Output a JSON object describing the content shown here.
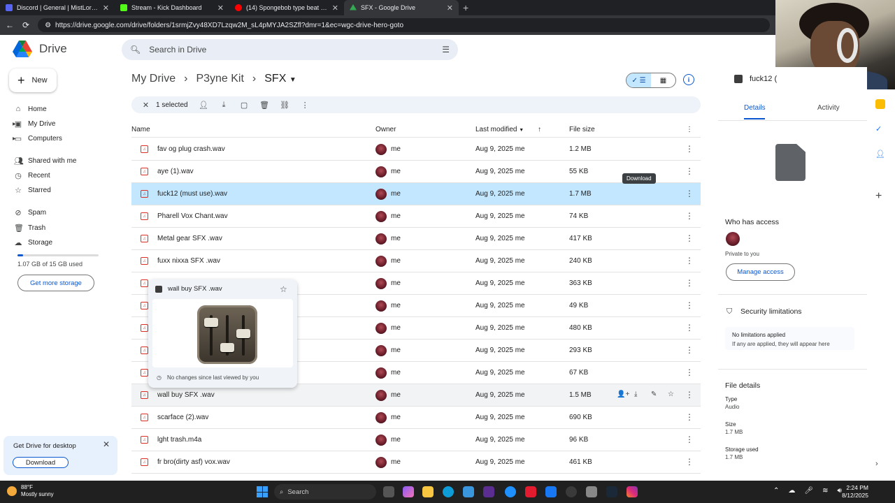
{
  "browser": {
    "tabs": [
      {
        "label": "Discord | General | MistLordRx's P...",
        "color": "#5865f2"
      },
      {
        "label": "Stream - Kick Dashboard",
        "color": "#53fc18"
      },
      {
        "label": "(14) Spongebob type beat p...",
        "color": "#ff0000"
      },
      {
        "label": "SFX - Google Drive",
        "color": "#34a853"
      }
    ],
    "url": "https://drive.google.com/drive/folders/1srmjZvy48XD7Lzqw2M_sL4pMYJA2SZfl?dmr=1&ec=wgc-drive-hero-goto"
  },
  "header": {
    "app_name": "Drive",
    "search_placeholder": "Search in Drive"
  },
  "sidebar": {
    "new_label": "New",
    "items": [
      {
        "label": "Home",
        "icon": "home-icon"
      },
      {
        "label": "My Drive",
        "icon": "drive-icon"
      },
      {
        "label": "Computers",
        "icon": "computer-icon"
      },
      {
        "label": "Shared with me",
        "icon": "people-icon"
      },
      {
        "label": "Recent",
        "icon": "clock-icon"
      },
      {
        "label": "Starred",
        "icon": "star-icon"
      },
      {
        "label": "Spam",
        "icon": "spam-icon"
      },
      {
        "label": "Trash",
        "icon": "trash-icon"
      },
      {
        "label": "Storage",
        "icon": "cloud-icon"
      }
    ],
    "storage_text": "1.07 GB of 15 GB used",
    "storage_fraction": 0.071,
    "get_more_label": "Get more storage",
    "desktop_promo": {
      "title": "Get Drive for desktop",
      "button": "Download"
    }
  },
  "main": {
    "breadcrumbs": [
      "My Drive",
      "P3yne Kit",
      "SFX"
    ],
    "selection": {
      "count_label": "1 selected"
    },
    "columns": {
      "name": "Name",
      "owner": "Owner",
      "modified": "Last modified",
      "size": "File size"
    },
    "tooltip": "Download",
    "files": [
      {
        "name": "fav og plug crash.wav",
        "owner": "me",
        "modified": "Aug 9, 2025 me",
        "size": "1.2 MB"
      },
      {
        "name": "aye (1).wav",
        "owner": "me",
        "modified": "Aug 9, 2025 me",
        "size": "55 KB"
      },
      {
        "name": "fuck12 (must use).wav",
        "owner": "me",
        "modified": "Aug 9, 2025 me",
        "size": "1.7 MB"
      },
      {
        "name": "Pharell Vox Chant.wav",
        "owner": "me",
        "modified": "Aug 9, 2025 me",
        "size": "74 KB"
      },
      {
        "name": "Metal gear SFX .wav",
        "owner": "me",
        "modified": "Aug 9, 2025 me",
        "size": "417 KB"
      },
      {
        "name": "fuxx nixxa SFX .wav",
        "owner": "me",
        "modified": "Aug 9, 2025 me",
        "size": "240 KB"
      },
      {
        "name": "",
        "owner": "me",
        "modified": "Aug 9, 2025 me",
        "size": "363 KB"
      },
      {
        "name": "",
        "owner": "me",
        "modified": "Aug 9, 2025 me",
        "size": "49 KB"
      },
      {
        "name": "",
        "owner": "me",
        "modified": "Aug 9, 2025 me",
        "size": "480 KB"
      },
      {
        "name": "",
        "owner": "me",
        "modified": "Aug 9, 2025 me",
        "size": "293 KB"
      },
      {
        "name": "",
        "owner": "me",
        "modified": "Aug 9, 2025 me",
        "size": "67 KB"
      },
      {
        "name": "wall buy SFX .wav",
        "owner": "me",
        "modified": "Aug 9, 2025 me",
        "size": "1.5 MB"
      },
      {
        "name": "scarface  (2).wav",
        "owner": "me",
        "modified": "Aug 9, 2025 me",
        "size": "690 KB"
      },
      {
        "name": "lght trash.m4a",
        "owner": "me",
        "modified": "Aug 9, 2025 me",
        "size": "96 KB"
      },
      {
        "name": "fr bro(dirty asf) vox.wav",
        "owner": "me",
        "modified": "Aug 9, 2025 me",
        "size": "461 KB"
      }
    ],
    "hover_card": {
      "title": "wall buy SFX .wav",
      "footer": "No changes since last viewed by you"
    }
  },
  "details": {
    "title": "fuck12 (",
    "tabs": [
      "Details",
      "Activity"
    ],
    "who_has_access": "Who has access",
    "private_text": "Private to you",
    "manage_access": "Manage access",
    "security_title": "Security limitations",
    "no_limits": "No limitations applied",
    "no_limits_sub": "If any are applied, they will appear here",
    "file_details": "File details",
    "type_label": "Type",
    "type_value": "Audio",
    "size_label": "Size",
    "size_value": "1.7 MB",
    "storage_label": "Storage used",
    "storage_value": "1.7 MB"
  },
  "taskbar": {
    "temp": "88°F",
    "weather": "Mostly sunny",
    "search": "Search",
    "time": "2:24 PM",
    "date": "8/12/2025"
  }
}
